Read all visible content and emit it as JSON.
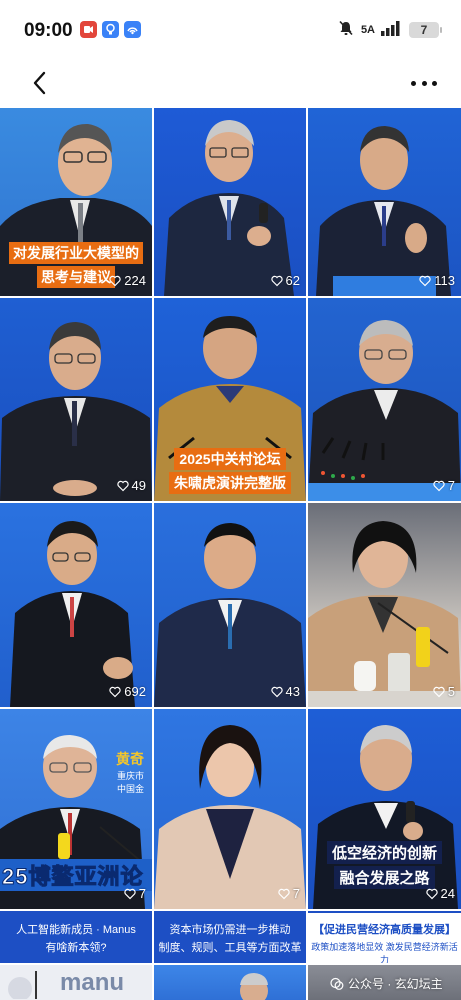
{
  "status_bar": {
    "time": "09:00",
    "network": "5A",
    "battery": "7",
    "app_icons": [
      {
        "name": "video-app-icon",
        "color": "#e2463b"
      },
      {
        "name": "bulb-app-icon",
        "color": "#3a82f7"
      },
      {
        "name": "hotspot-app-icon",
        "color": "#3a82f7"
      }
    ]
  },
  "topbar": {
    "back_icon": "chevron-left-icon",
    "more_icon": "more-dots-icon"
  },
  "tiles": [
    {
      "likes": "224",
      "title_lines": [
        "对发展行业大模型的",
        "思考与建议"
      ]
    },
    {
      "likes": "62"
    },
    {
      "likes": "113"
    },
    {
      "likes": "49"
    },
    {
      "likes": "",
      "title_lines": [
        "2025中关村论坛",
        "朱啸虎演讲完整版"
      ]
    },
    {
      "likes": "7"
    },
    {
      "likes": "692"
    },
    {
      "likes": "43"
    },
    {
      "likes": "5"
    },
    {
      "likes": "7",
      "name_tag": [
        "黄奇",
        "重庆市",
        "中国金"
      ],
      "banner": "25博鳌亚洲论"
    },
    {
      "likes": "7"
    },
    {
      "likes": "24",
      "title_lines": [
        "低空经济的创新",
        "融合发展之路"
      ]
    }
  ],
  "captions": [
    {
      "line1": "人工智能新成员 · Manus",
      "line2": "有啥新本领?"
    },
    {
      "line1": "资本市场仍需进一步推动",
      "line2": "制度、规则、工具等方面改革"
    },
    {
      "line1": "【促进民营经济高质量发展】",
      "line2": "政策加速落地显效 激发民营经济新活力"
    }
  ],
  "watermark": "公众号 · 玄幻坛主",
  "partial_logo": "manu",
  "colors": {
    "tile_blue": "#1f56c9",
    "caption_blue": "#1d4fc4"
  }
}
